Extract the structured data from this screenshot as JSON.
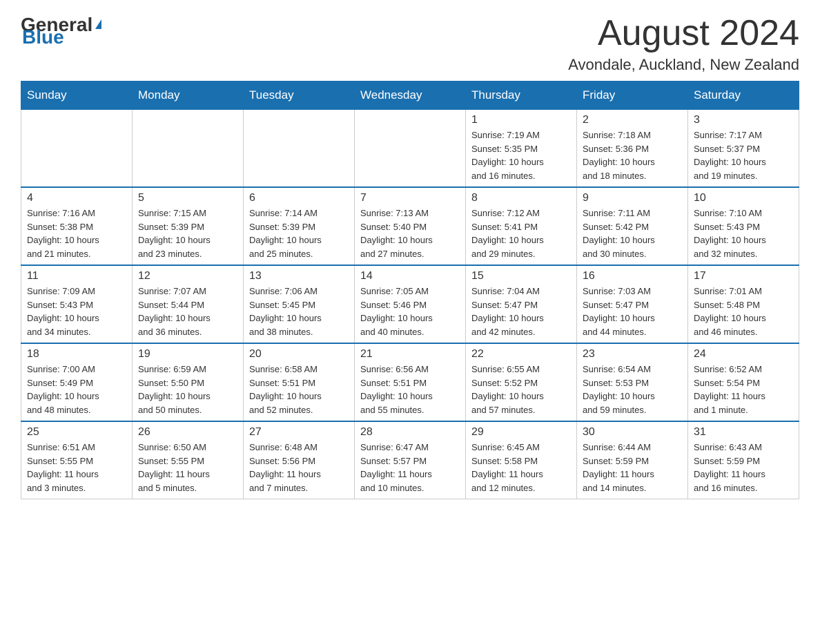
{
  "header": {
    "logo_general": "General",
    "logo_blue": "Blue",
    "month_title": "August 2024",
    "location": "Avondale, Auckland, New Zealand"
  },
  "days_of_week": [
    "Sunday",
    "Monday",
    "Tuesday",
    "Wednesday",
    "Thursday",
    "Friday",
    "Saturday"
  ],
  "weeks": [
    [
      {
        "day": "",
        "info": ""
      },
      {
        "day": "",
        "info": ""
      },
      {
        "day": "",
        "info": ""
      },
      {
        "day": "",
        "info": ""
      },
      {
        "day": "1",
        "info": "Sunrise: 7:19 AM\nSunset: 5:35 PM\nDaylight: 10 hours\nand 16 minutes."
      },
      {
        "day": "2",
        "info": "Sunrise: 7:18 AM\nSunset: 5:36 PM\nDaylight: 10 hours\nand 18 minutes."
      },
      {
        "day": "3",
        "info": "Sunrise: 7:17 AM\nSunset: 5:37 PM\nDaylight: 10 hours\nand 19 minutes."
      }
    ],
    [
      {
        "day": "4",
        "info": "Sunrise: 7:16 AM\nSunset: 5:38 PM\nDaylight: 10 hours\nand 21 minutes."
      },
      {
        "day": "5",
        "info": "Sunrise: 7:15 AM\nSunset: 5:39 PM\nDaylight: 10 hours\nand 23 minutes."
      },
      {
        "day": "6",
        "info": "Sunrise: 7:14 AM\nSunset: 5:39 PM\nDaylight: 10 hours\nand 25 minutes."
      },
      {
        "day": "7",
        "info": "Sunrise: 7:13 AM\nSunset: 5:40 PM\nDaylight: 10 hours\nand 27 minutes."
      },
      {
        "day": "8",
        "info": "Sunrise: 7:12 AM\nSunset: 5:41 PM\nDaylight: 10 hours\nand 29 minutes."
      },
      {
        "day": "9",
        "info": "Sunrise: 7:11 AM\nSunset: 5:42 PM\nDaylight: 10 hours\nand 30 minutes."
      },
      {
        "day": "10",
        "info": "Sunrise: 7:10 AM\nSunset: 5:43 PM\nDaylight: 10 hours\nand 32 minutes."
      }
    ],
    [
      {
        "day": "11",
        "info": "Sunrise: 7:09 AM\nSunset: 5:43 PM\nDaylight: 10 hours\nand 34 minutes."
      },
      {
        "day": "12",
        "info": "Sunrise: 7:07 AM\nSunset: 5:44 PM\nDaylight: 10 hours\nand 36 minutes."
      },
      {
        "day": "13",
        "info": "Sunrise: 7:06 AM\nSunset: 5:45 PM\nDaylight: 10 hours\nand 38 minutes."
      },
      {
        "day": "14",
        "info": "Sunrise: 7:05 AM\nSunset: 5:46 PM\nDaylight: 10 hours\nand 40 minutes."
      },
      {
        "day": "15",
        "info": "Sunrise: 7:04 AM\nSunset: 5:47 PM\nDaylight: 10 hours\nand 42 minutes."
      },
      {
        "day": "16",
        "info": "Sunrise: 7:03 AM\nSunset: 5:47 PM\nDaylight: 10 hours\nand 44 minutes."
      },
      {
        "day": "17",
        "info": "Sunrise: 7:01 AM\nSunset: 5:48 PM\nDaylight: 10 hours\nand 46 minutes."
      }
    ],
    [
      {
        "day": "18",
        "info": "Sunrise: 7:00 AM\nSunset: 5:49 PM\nDaylight: 10 hours\nand 48 minutes."
      },
      {
        "day": "19",
        "info": "Sunrise: 6:59 AM\nSunset: 5:50 PM\nDaylight: 10 hours\nand 50 minutes."
      },
      {
        "day": "20",
        "info": "Sunrise: 6:58 AM\nSunset: 5:51 PM\nDaylight: 10 hours\nand 52 minutes."
      },
      {
        "day": "21",
        "info": "Sunrise: 6:56 AM\nSunset: 5:51 PM\nDaylight: 10 hours\nand 55 minutes."
      },
      {
        "day": "22",
        "info": "Sunrise: 6:55 AM\nSunset: 5:52 PM\nDaylight: 10 hours\nand 57 minutes."
      },
      {
        "day": "23",
        "info": "Sunrise: 6:54 AM\nSunset: 5:53 PM\nDaylight: 10 hours\nand 59 minutes."
      },
      {
        "day": "24",
        "info": "Sunrise: 6:52 AM\nSunset: 5:54 PM\nDaylight: 11 hours\nand 1 minute."
      }
    ],
    [
      {
        "day": "25",
        "info": "Sunrise: 6:51 AM\nSunset: 5:55 PM\nDaylight: 11 hours\nand 3 minutes."
      },
      {
        "day": "26",
        "info": "Sunrise: 6:50 AM\nSunset: 5:55 PM\nDaylight: 11 hours\nand 5 minutes."
      },
      {
        "day": "27",
        "info": "Sunrise: 6:48 AM\nSunset: 5:56 PM\nDaylight: 11 hours\nand 7 minutes."
      },
      {
        "day": "28",
        "info": "Sunrise: 6:47 AM\nSunset: 5:57 PM\nDaylight: 11 hours\nand 10 minutes."
      },
      {
        "day": "29",
        "info": "Sunrise: 6:45 AM\nSunset: 5:58 PM\nDaylight: 11 hours\nand 12 minutes."
      },
      {
        "day": "30",
        "info": "Sunrise: 6:44 AM\nSunset: 5:59 PM\nDaylight: 11 hours\nand 14 minutes."
      },
      {
        "day": "31",
        "info": "Sunrise: 6:43 AM\nSunset: 5:59 PM\nDaylight: 11 hours\nand 16 minutes."
      }
    ]
  ]
}
